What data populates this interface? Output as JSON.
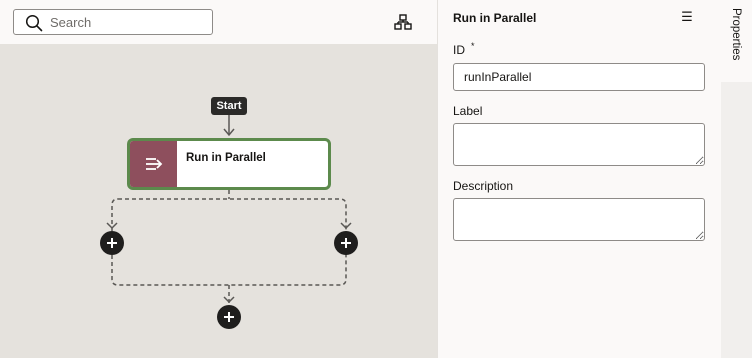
{
  "search": {
    "placeholder": "Search",
    "value": ""
  },
  "canvas": {
    "start_label": "Start",
    "node": {
      "title": "Run in Parallel",
      "icon": "parallel-arrows-icon",
      "color": "#8e4f5d",
      "border_color": "#5c8a4c"
    }
  },
  "properties": {
    "title": "Run in Parallel",
    "menu_icon": "☰",
    "id_label": "ID",
    "id_required": "*",
    "id_value": "runInParallel",
    "label_label": "Label",
    "label_value": "",
    "description_label": "Description",
    "description_value": ""
  },
  "tabs": {
    "properties_label": "Properties"
  }
}
